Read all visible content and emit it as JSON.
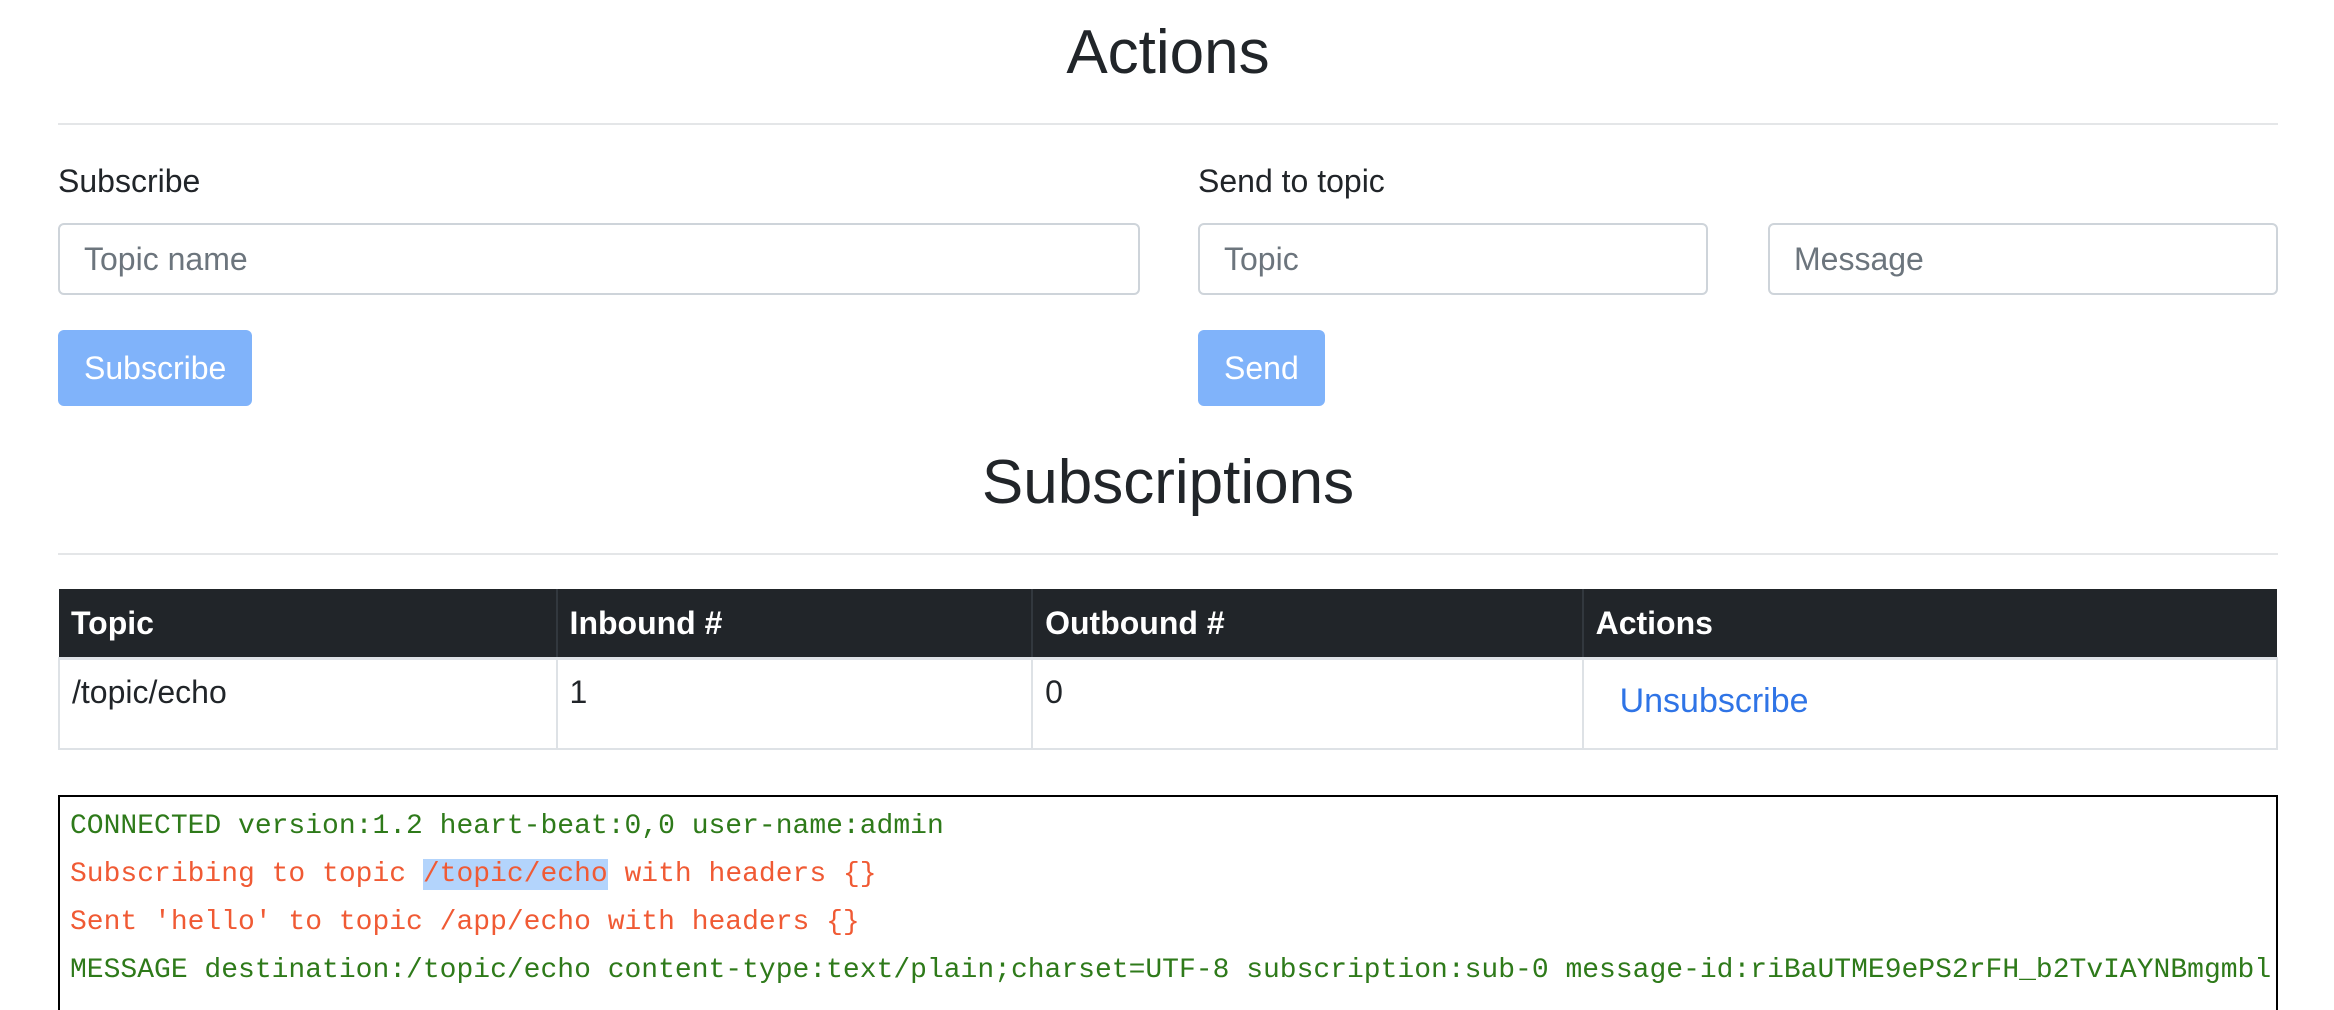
{
  "actions": {
    "title": "Actions",
    "subscribe": {
      "label": "Subscribe",
      "topic_placeholder": "Topic name",
      "topic_value": "",
      "button_label": "Subscribe"
    },
    "send": {
      "label": "Send to topic",
      "topic_placeholder": "Topic",
      "topic_value": "",
      "message_placeholder": "Message",
      "message_value": "",
      "button_label": "Send"
    }
  },
  "subscriptions": {
    "title": "Subscriptions",
    "columns": [
      "Topic",
      "Inbound #",
      "Outbound #",
      "Actions"
    ],
    "rows": [
      {
        "topic": "/topic/echo",
        "inbound": "1",
        "outbound": "0",
        "action_label": "Unsubscribe"
      }
    ]
  },
  "console": {
    "lines": [
      {
        "text": "CONNECTED version:1.2 heart-beat:0,0 user-name:admin",
        "color": "#2e7a1a"
      },
      {
        "prefix": "Subscribing to topic ",
        "highlight": "/topic/echo",
        "suffix": " with headers {}",
        "color": "#f05a34"
      },
      {
        "text": "Sent 'hello' to topic /app/echo with headers {}",
        "color": "#f05a34"
      },
      {
        "text": "MESSAGE destination:/topic/echo content-type:text/plain;charset=UTF-8 subscription:sub-0 message-id:riBaUTME9ePS2rFH_b2TvIAYNBmgmbl",
        "color": "#2e7a1a"
      }
    ]
  },
  "colors": {
    "button_bg": "#80b3fa",
    "table_header_bg": "#212529",
    "link": "#2f74e6",
    "console_green": "#2e7a1a",
    "console_orange": "#f05a34",
    "selection": "#b3d4fc"
  }
}
